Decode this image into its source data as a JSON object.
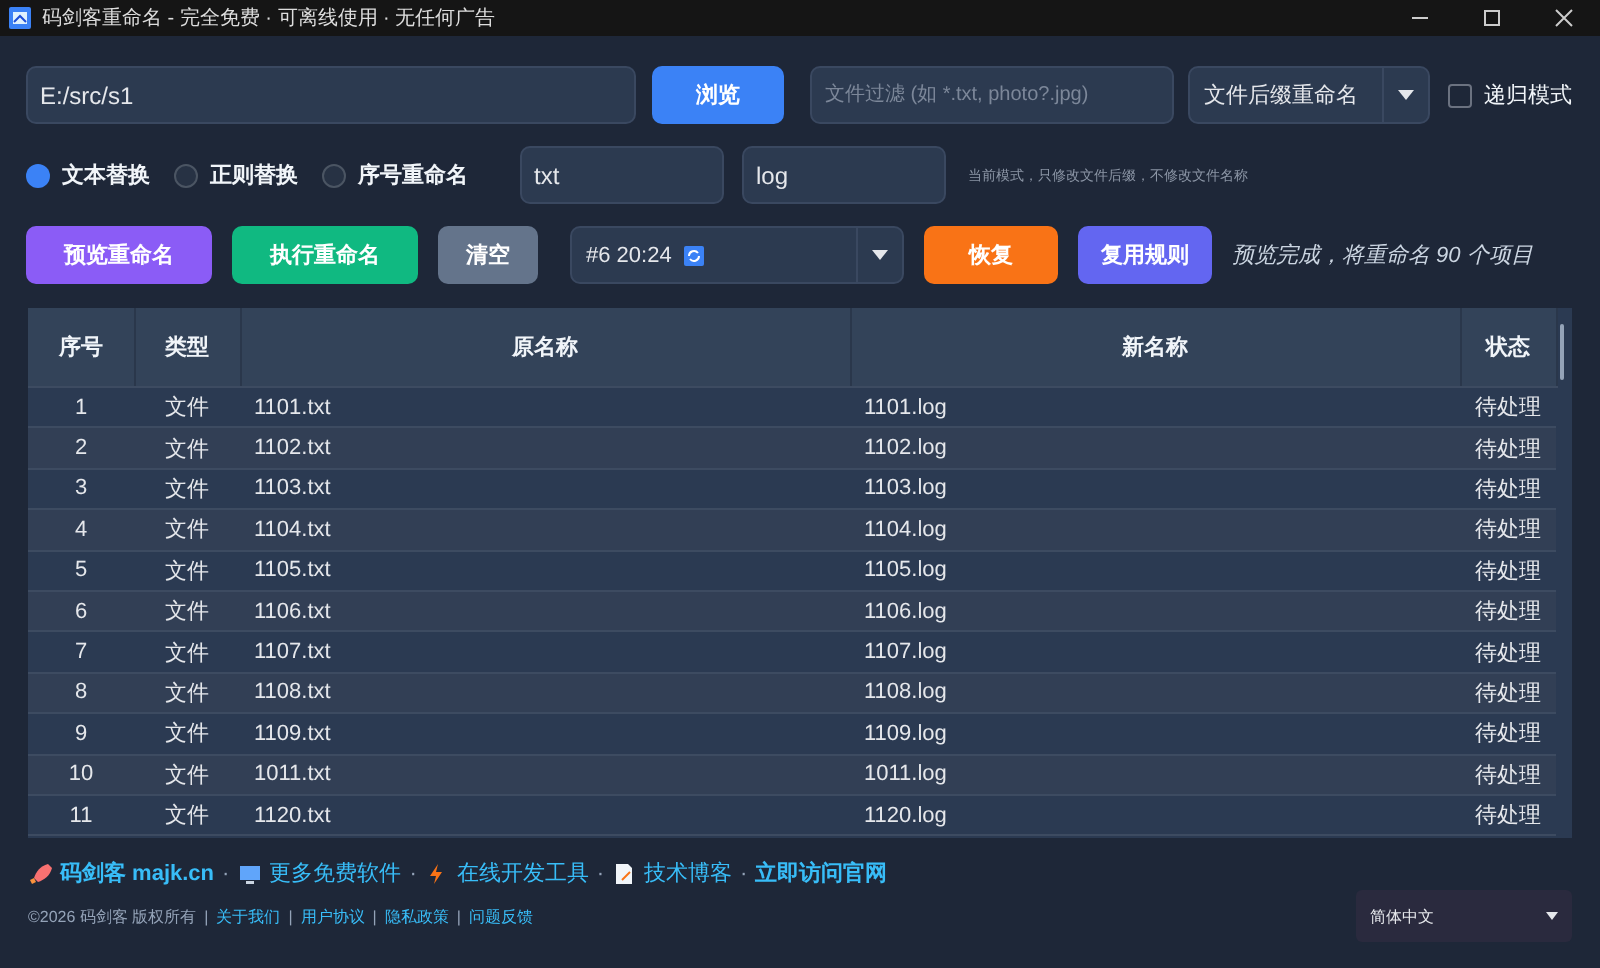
{
  "window": {
    "title": "码剑客重命名 - 完全免费 · 可离线使用 · 无任何广告"
  },
  "path": {
    "value": "E:/src/s1"
  },
  "browse_button": "浏览",
  "filter": {
    "placeholder": "文件过滤 (如 *.txt, photo?.jpg)"
  },
  "mode_select": {
    "value": "文件后缀重命名"
  },
  "recursive": {
    "label": "递归模式",
    "checked": false
  },
  "modes": [
    {
      "label": "文本替换",
      "selected": true
    },
    {
      "label": "正则替换",
      "selected": false
    },
    {
      "label": "序号重命名",
      "selected": false
    }
  ],
  "find": {
    "value": "txt"
  },
  "replace": {
    "value": "log"
  },
  "hint": "当前模式，只修改文件后缀，不修改文件名称",
  "actions": [
    {
      "label": "预览重命名",
      "color": "#8b5cf6"
    },
    {
      "label": "执行重命名",
      "color": "#10b981"
    },
    {
      "label": "清空",
      "color": "#64748b"
    }
  ],
  "history": {
    "value": "#6 20:24"
  },
  "actions2": [
    {
      "label": "恢复",
      "color": "#f97316"
    },
    {
      "label": "复用规则",
      "color": "#6366f1"
    }
  ],
  "status_message": "预览完成，将重命名 90 个项目",
  "table": {
    "columns": [
      "序号",
      "类型",
      "原名称",
      "新名称",
      "状态"
    ],
    "rows": [
      [
        "1",
        "文件",
        "1101.txt",
        "1101.log",
        "待处理"
      ],
      [
        "2",
        "文件",
        "1102.txt",
        "1102.log",
        "待处理"
      ],
      [
        "3",
        "文件",
        "1103.txt",
        "1103.log",
        "待处理"
      ],
      [
        "4",
        "文件",
        "1104.txt",
        "1104.log",
        "待处理"
      ],
      [
        "5",
        "文件",
        "1105.txt",
        "1105.log",
        "待处理"
      ],
      [
        "6",
        "文件",
        "1106.txt",
        "1106.log",
        "待处理"
      ],
      [
        "7",
        "文件",
        "1107.txt",
        "1107.log",
        "待处理"
      ],
      [
        "8",
        "文件",
        "1108.txt",
        "1108.log",
        "待处理"
      ],
      [
        "9",
        "文件",
        "1109.txt",
        "1109.log",
        "待处理"
      ],
      [
        "10",
        "文件",
        "1011.txt",
        "1011.log",
        "待处理"
      ],
      [
        "11",
        "文件",
        "1120.txt",
        "1120.log",
        "待处理"
      ]
    ]
  },
  "footer": {
    "links": [
      {
        "kind": "rocket",
        "label": "码剑客 majk.cn"
      },
      {
        "kind": "monitor",
        "label": "更多免费软件"
      },
      {
        "kind": "bolt",
        "label": "在线开发工具"
      },
      {
        "kind": "doc",
        "label": "技术博客"
      },
      {
        "kind": "none",
        "label": "立即访问官网"
      }
    ],
    "link_separator": "·",
    "copyright": "©2026 码剑客 版权所有",
    "legal_separator": "|",
    "legal_links": [
      "关于我们",
      "用户协议",
      "隐私政策",
      "问题反馈"
    ],
    "language": "简体中文"
  }
}
